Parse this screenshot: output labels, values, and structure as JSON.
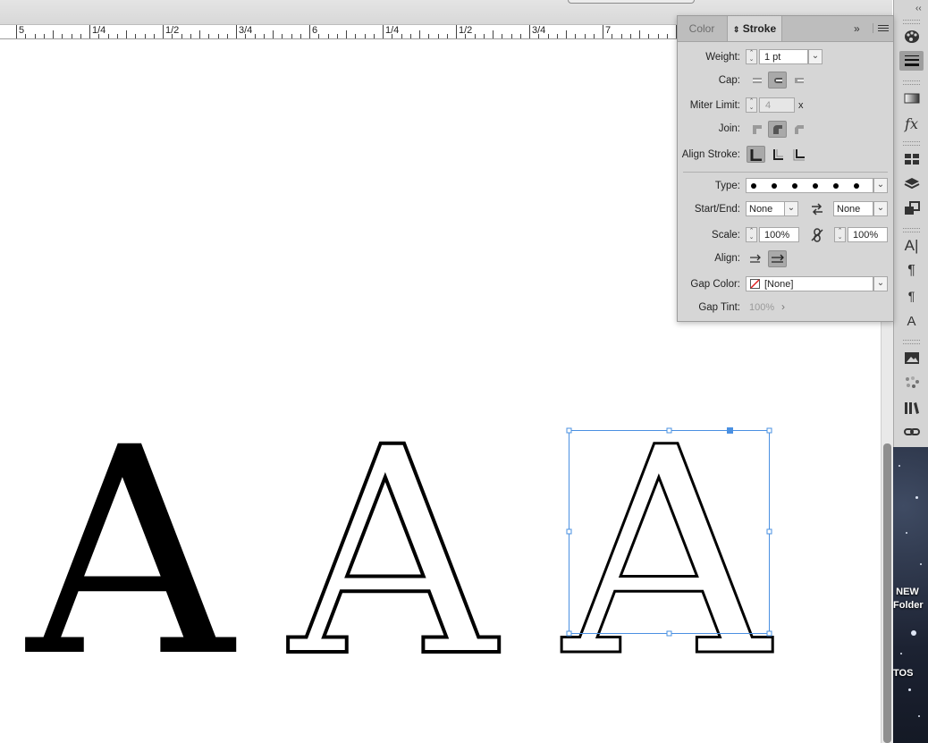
{
  "ruler": {
    "labels": [
      "5",
      "1/4",
      "1/2",
      "3/4",
      "6",
      "1/4",
      "1/2",
      "3/4",
      "7"
    ]
  },
  "canvas": {
    "letters": [
      "A",
      "A",
      "A"
    ]
  },
  "panel": {
    "tabs": {
      "color": "Color",
      "stroke": "Stroke"
    },
    "weight": {
      "label": "Weight:",
      "value": "1 pt"
    },
    "cap": {
      "label": "Cap:"
    },
    "miter": {
      "label": "Miter Limit:",
      "value": "4",
      "unit": "x"
    },
    "join": {
      "label": "Join:"
    },
    "align_stroke": {
      "label": "Align Stroke:"
    },
    "type": {
      "label": "Type:"
    },
    "start_end": {
      "label": "Start/End:",
      "start": "None",
      "end": "None"
    },
    "scale": {
      "label": "Scale:",
      "start": "100%",
      "end": "100%"
    },
    "align": {
      "label": "Align:"
    },
    "gap_color": {
      "label": "Gap Color:",
      "value": "[None]"
    },
    "gap_tint": {
      "label": "Gap Tint:",
      "value": "100%"
    }
  },
  "desktop": {
    "folder_label_1": "NEW",
    "folder_label_2": "Folder",
    "partial_label": "TOS"
  },
  "colors": {
    "selection": "#4a90e2",
    "panel_bg": "#d6d6d6",
    "active_button": "#a9a9a9"
  }
}
